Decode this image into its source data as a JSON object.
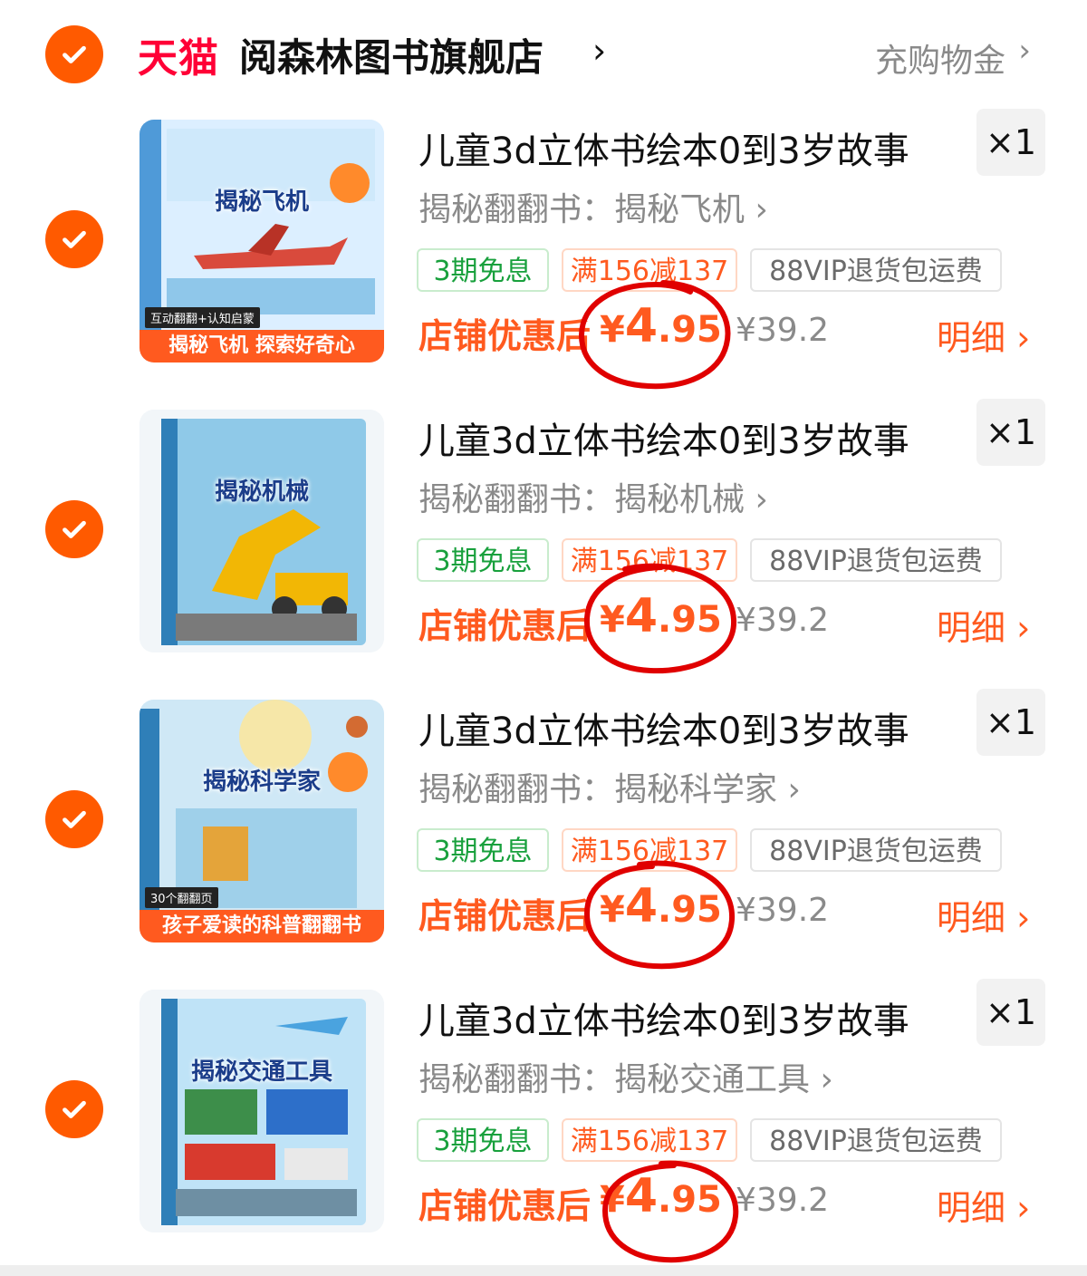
{
  "store": {
    "brand": "天猫",
    "name": "阅森林图书旗舰店",
    "chevron": "›",
    "coin_link": "充购物金",
    "coin_chevron": "›"
  },
  "colors": {
    "accent": "#ff5a00",
    "price": "#ff5a1f",
    "tmall": "#ff0036",
    "installment_tag": "#18a03c",
    "annotation_circle": "#e00000"
  },
  "items": [
    {
      "title": "儿童3d立体书绘本0到3岁故事",
      "quantity": "×1",
      "spec": "揭秘翻翻书：揭秘飞机 ›",
      "cover_title": "揭秘飞机",
      "cover_banner": "揭秘飞机 探索好奇心",
      "cover_badge": "互动翻翻+认知启蒙",
      "tags": [
        "3期免息",
        "满156减137",
        "88VIP退货包运费"
      ],
      "promo_label": "店铺优惠后",
      "price_symbol": "¥",
      "price_int": "4",
      "price_dec": ".95",
      "original_price": "¥39.2",
      "detail_link": "明细 ›"
    },
    {
      "title": "儿童3d立体书绘本0到3岁故事",
      "quantity": "×1",
      "spec": "揭秘翻翻书：揭秘机械 ›",
      "cover_title": "揭秘机械",
      "cover_banner": "",
      "cover_badge": "",
      "tags": [
        "3期免息",
        "满156减137",
        "88VIP退货包运费"
      ],
      "promo_label": "店铺优惠后",
      "price_symbol": "¥",
      "price_int": "4",
      "price_dec": ".95",
      "original_price": "¥39.2",
      "detail_link": "明细 ›"
    },
    {
      "title": "儿童3d立体书绘本0到3岁故事",
      "quantity": "×1",
      "spec": "揭秘翻翻书：揭秘科学家 ›",
      "cover_title": "揭秘科学家",
      "cover_banner": "孩子爱读的科普翻翻书",
      "cover_badge": "30个翻翻页",
      "tags": [
        "3期免息",
        "满156减137",
        "88VIP退货包运费"
      ],
      "promo_label": "店铺优惠后",
      "price_symbol": "¥",
      "price_int": "4",
      "price_dec": ".95",
      "original_price": "¥39.2",
      "detail_link": "明细 ›"
    },
    {
      "title": "儿童3d立体书绘本0到3岁故事",
      "quantity": "×1",
      "spec": "揭秘翻翻书：揭秘交通工具 ›",
      "cover_title": "揭秘交通工具",
      "cover_banner": "",
      "cover_badge": "",
      "tags": [
        "3期免息",
        "满156减137",
        "88VIP退货包运费"
      ],
      "promo_label": "店铺优惠后",
      "price_symbol": "¥",
      "price_int": "4",
      "price_dec": ".95",
      "original_price": "¥39.2",
      "detail_link": "明细 ›"
    }
  ]
}
